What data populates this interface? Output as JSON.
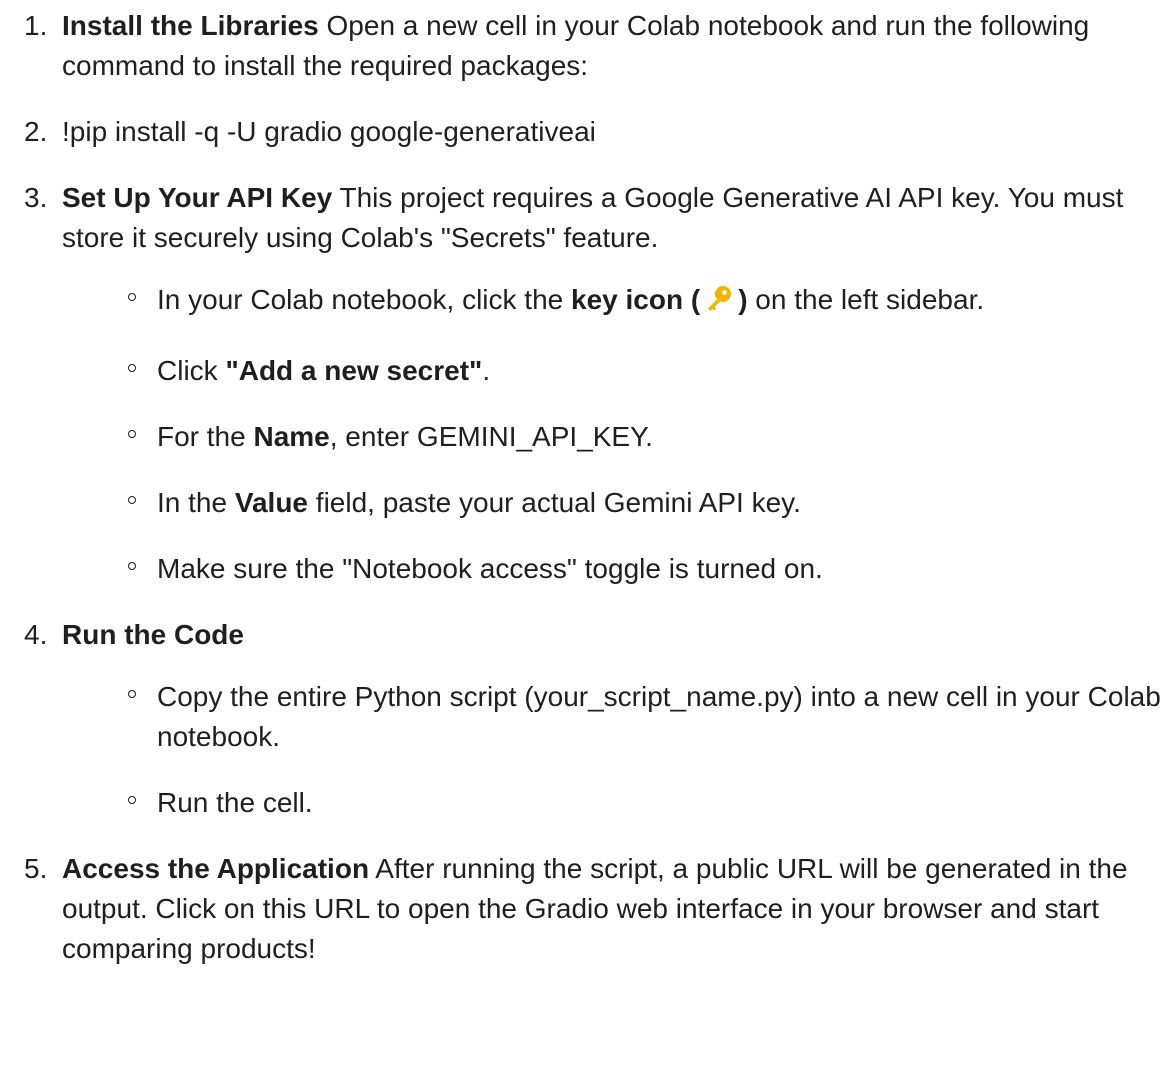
{
  "steps": [
    {
      "number": "1.",
      "title": "Install the Libraries",
      "text": " Open a new cell in your Colab notebook and run the following command to install the required packages:"
    },
    {
      "number": "2.",
      "text": "!pip install -q -U gradio google-generativeai"
    },
    {
      "number": "3.",
      "title": "Set Up Your API Key",
      "text": " This project requires a Google Generative AI API key. You must store it securely using Colab's \"Secrets\" feature.",
      "items": [
        {
          "pre": "In your Colab notebook, click the ",
          "bold": "key icon (",
          "icon": "key-icon",
          "bold2": ")",
          "post": " on the left sidebar."
        },
        {
          "pre": "Click ",
          "bold": "\"Add a new secret\"",
          "post": "."
        },
        {
          "pre": "For the ",
          "bold": "Name",
          "post": ", enter GEMINI_API_KEY."
        },
        {
          "pre": "In the ",
          "bold": "Value",
          "post": " field, paste your actual Gemini API key."
        },
        {
          "text": "Make sure the \"Notebook access\" toggle is turned on."
        }
      ]
    },
    {
      "number": "4.",
      "title": "Run the Code",
      "items": [
        {
          "text": "Copy the entire Python script (your_script_name.py) into a new cell in your Colab notebook."
        },
        {
          "text": "Run the cell."
        }
      ]
    },
    {
      "number": "5.",
      "title": "Access the Application",
      "text": " After running the script, a public URL will be generated in the output. Click on this URL to open the Gradio web interface in your browser and start comparing products!"
    }
  ],
  "colors": {
    "text": "#1f1f1f",
    "key_icon": "#f4b400"
  }
}
